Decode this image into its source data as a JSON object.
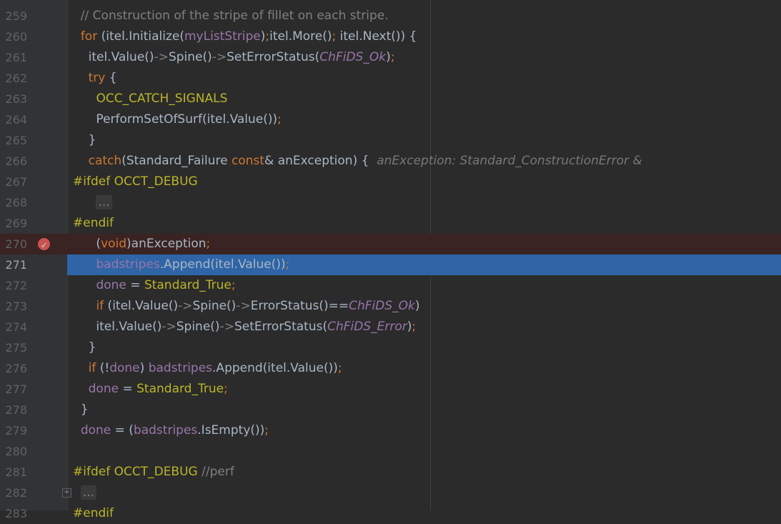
{
  "editor": {
    "lines": [
      {
        "n": "259",
        "tokens": [
          {
            "t": "  // Construction of the stripe of fillet on each stripe.",
            "c": "c-comment"
          }
        ]
      },
      {
        "n": "260",
        "tokens": [
          {
            "t": "  ",
            "c": ""
          },
          {
            "t": "for",
            "c": "c-kw"
          },
          {
            "t": " (itel.Initialize(",
            "c": ""
          },
          {
            "t": "myListStripe",
            "c": "c-field"
          },
          {
            "t": ")",
            "c": ""
          },
          {
            "t": ";",
            "c": "c-sem"
          },
          {
            "t": "itel.More()",
            "c": ""
          },
          {
            "t": ";",
            "c": "c-sem"
          },
          {
            "t": " itel.Next()) {",
            "c": ""
          }
        ]
      },
      {
        "n": "261",
        "tokens": [
          {
            "t": "    itel.Value()",
            "c": ""
          },
          {
            "t": "->",
            "c": "c-comment"
          },
          {
            "t": "Spine()",
            "c": ""
          },
          {
            "t": "->",
            "c": "c-comment"
          },
          {
            "t": "SetErrorStatus(",
            "c": ""
          },
          {
            "t": "ChFiDS_Ok",
            "c": "c-const"
          },
          {
            "t": ")",
            "c": ""
          },
          {
            "t": ";",
            "c": "c-sem"
          }
        ]
      },
      {
        "n": "262",
        "tokens": [
          {
            "t": "    ",
            "c": ""
          },
          {
            "t": "try",
            "c": "c-kw"
          },
          {
            "t": " {",
            "c": ""
          }
        ]
      },
      {
        "n": "263",
        "tokens": [
          {
            "t": "      ",
            "c": ""
          },
          {
            "t": "OCC_CATCH_SIGNALS",
            "c": "c-macro"
          }
        ]
      },
      {
        "n": "264",
        "tokens": [
          {
            "t": "      PerformSetOfSurf(itel.Value())",
            "c": ""
          },
          {
            "t": ";",
            "c": "c-sem"
          }
        ]
      },
      {
        "n": "265",
        "tokens": [
          {
            "t": "    }",
            "c": ""
          }
        ]
      },
      {
        "n": "266",
        "tokens": [
          {
            "t": "    ",
            "c": ""
          },
          {
            "t": "catch",
            "c": "c-kw"
          },
          {
            "t": "(Standard_Failure ",
            "c": ""
          },
          {
            "t": "const",
            "c": "c-kw"
          },
          {
            "t": "& anException) {  ",
            "c": ""
          },
          {
            "t": "anException: Standard_ConstructionError &",
            "c": "c-hint"
          }
        ]
      },
      {
        "n": "267",
        "tokens": [
          {
            "t": "#ifdef ",
            "c": "c-pre"
          },
          {
            "t": "OCCT_DEBUG",
            "c": "c-macro"
          }
        ]
      },
      {
        "n": "268",
        "tokens": [
          {
            "t": "      ",
            "c": ""
          },
          {
            "t": "...",
            "c": "c-fold"
          }
        ]
      },
      {
        "n": "269",
        "tokens": [
          {
            "t": "#endif",
            "c": "c-pre"
          }
        ]
      },
      {
        "n": "270",
        "tokens": [
          {
            "t": "      (",
            "c": ""
          },
          {
            "t": "void",
            "c": "c-kw"
          },
          {
            "t": ")anException",
            "c": ""
          },
          {
            "t": ";",
            "c": "c-sem"
          }
        ]
      },
      {
        "n": "271",
        "tokens": [
          {
            "t": "      ",
            "c": ""
          },
          {
            "t": "badstripes",
            "c": "c-field"
          },
          {
            "t": ".Append(itel.Value())",
            "c": ""
          },
          {
            "t": ";",
            "c": "c-sem"
          }
        ]
      },
      {
        "n": "272",
        "tokens": [
          {
            "t": "      ",
            "c": ""
          },
          {
            "t": "done",
            "c": "c-field"
          },
          {
            "t": " = ",
            "c": ""
          },
          {
            "t": "Standard_True",
            "c": "c-macro"
          },
          {
            "t": ";",
            "c": "c-sem"
          }
        ]
      },
      {
        "n": "273",
        "tokens": [
          {
            "t": "      ",
            "c": ""
          },
          {
            "t": "if",
            "c": "c-kw"
          },
          {
            "t": " (itel.Value()",
            "c": ""
          },
          {
            "t": "->",
            "c": "c-comment"
          },
          {
            "t": "Spine()",
            "c": ""
          },
          {
            "t": "->",
            "c": "c-comment"
          },
          {
            "t": "ErrorStatus()==",
            "c": ""
          },
          {
            "t": "ChFiDS_Ok",
            "c": "c-const"
          },
          {
            "t": ")",
            "c": ""
          }
        ]
      },
      {
        "n": "274",
        "tokens": [
          {
            "t": "      itel.Value()",
            "c": ""
          },
          {
            "t": "->",
            "c": "c-comment"
          },
          {
            "t": "Spine()",
            "c": ""
          },
          {
            "t": "->",
            "c": "c-comment"
          },
          {
            "t": "SetErrorStatus(",
            "c": ""
          },
          {
            "t": "ChFiDS_Error",
            "c": "c-const"
          },
          {
            "t": ")",
            "c": ""
          },
          {
            "t": ";",
            "c": "c-sem"
          }
        ]
      },
      {
        "n": "275",
        "tokens": [
          {
            "t": "    }",
            "c": ""
          }
        ]
      },
      {
        "n": "276",
        "tokens": [
          {
            "t": "    ",
            "c": ""
          },
          {
            "t": "if",
            "c": "c-kw"
          },
          {
            "t": " (!",
            "c": ""
          },
          {
            "t": "done",
            "c": "c-field"
          },
          {
            "t": ") ",
            "c": ""
          },
          {
            "t": "badstripes",
            "c": "c-field"
          },
          {
            "t": ".Append(itel.Value())",
            "c": ""
          },
          {
            "t": ";",
            "c": "c-sem"
          }
        ]
      },
      {
        "n": "277",
        "tokens": [
          {
            "t": "    ",
            "c": ""
          },
          {
            "t": "done",
            "c": "c-field"
          },
          {
            "t": " = ",
            "c": ""
          },
          {
            "t": "Standard_True",
            "c": "c-macro"
          },
          {
            "t": ";",
            "c": "c-sem"
          }
        ]
      },
      {
        "n": "278",
        "tokens": [
          {
            "t": "  }",
            "c": ""
          }
        ]
      },
      {
        "n": "279",
        "tokens": [
          {
            "t": "  ",
            "c": ""
          },
          {
            "t": "done",
            "c": "c-field"
          },
          {
            "t": " = (",
            "c": ""
          },
          {
            "t": "badstripes",
            "c": "c-field"
          },
          {
            "t": ".IsEmpty())",
            "c": ""
          },
          {
            "t": ";",
            "c": "c-sem"
          }
        ]
      },
      {
        "n": "280",
        "tokens": []
      },
      {
        "n": "281",
        "tokens": [
          {
            "t": "#ifdef ",
            "c": "c-pre"
          },
          {
            "t": "OCCT_DEBUG",
            "c": "c-macro"
          },
          {
            "t": " //perf",
            "c": "c-comment"
          }
        ]
      },
      {
        "n": "282",
        "tokens": [
          {
            "t": "  ",
            "c": ""
          },
          {
            "t": "...",
            "c": "c-fold"
          }
        ]
      },
      {
        "n": "283",
        "tokens": [
          {
            "t": "#endif",
            "c": "c-pre"
          }
        ]
      }
    ],
    "breakpoint_line": "270",
    "selected_line": "271",
    "fold_line": "282",
    "breakpoint_icon": "breakpoint-check-icon",
    "fold_icon": "fold-expand-icon",
    "colors": {
      "background": "#2b2b2b",
      "selection": "#2f65a6",
      "breakpoint_bg": "#3a2323",
      "keyword": "#cc7832",
      "field": "#9876aa",
      "macro": "#bbb529",
      "comment": "#808080"
    }
  }
}
